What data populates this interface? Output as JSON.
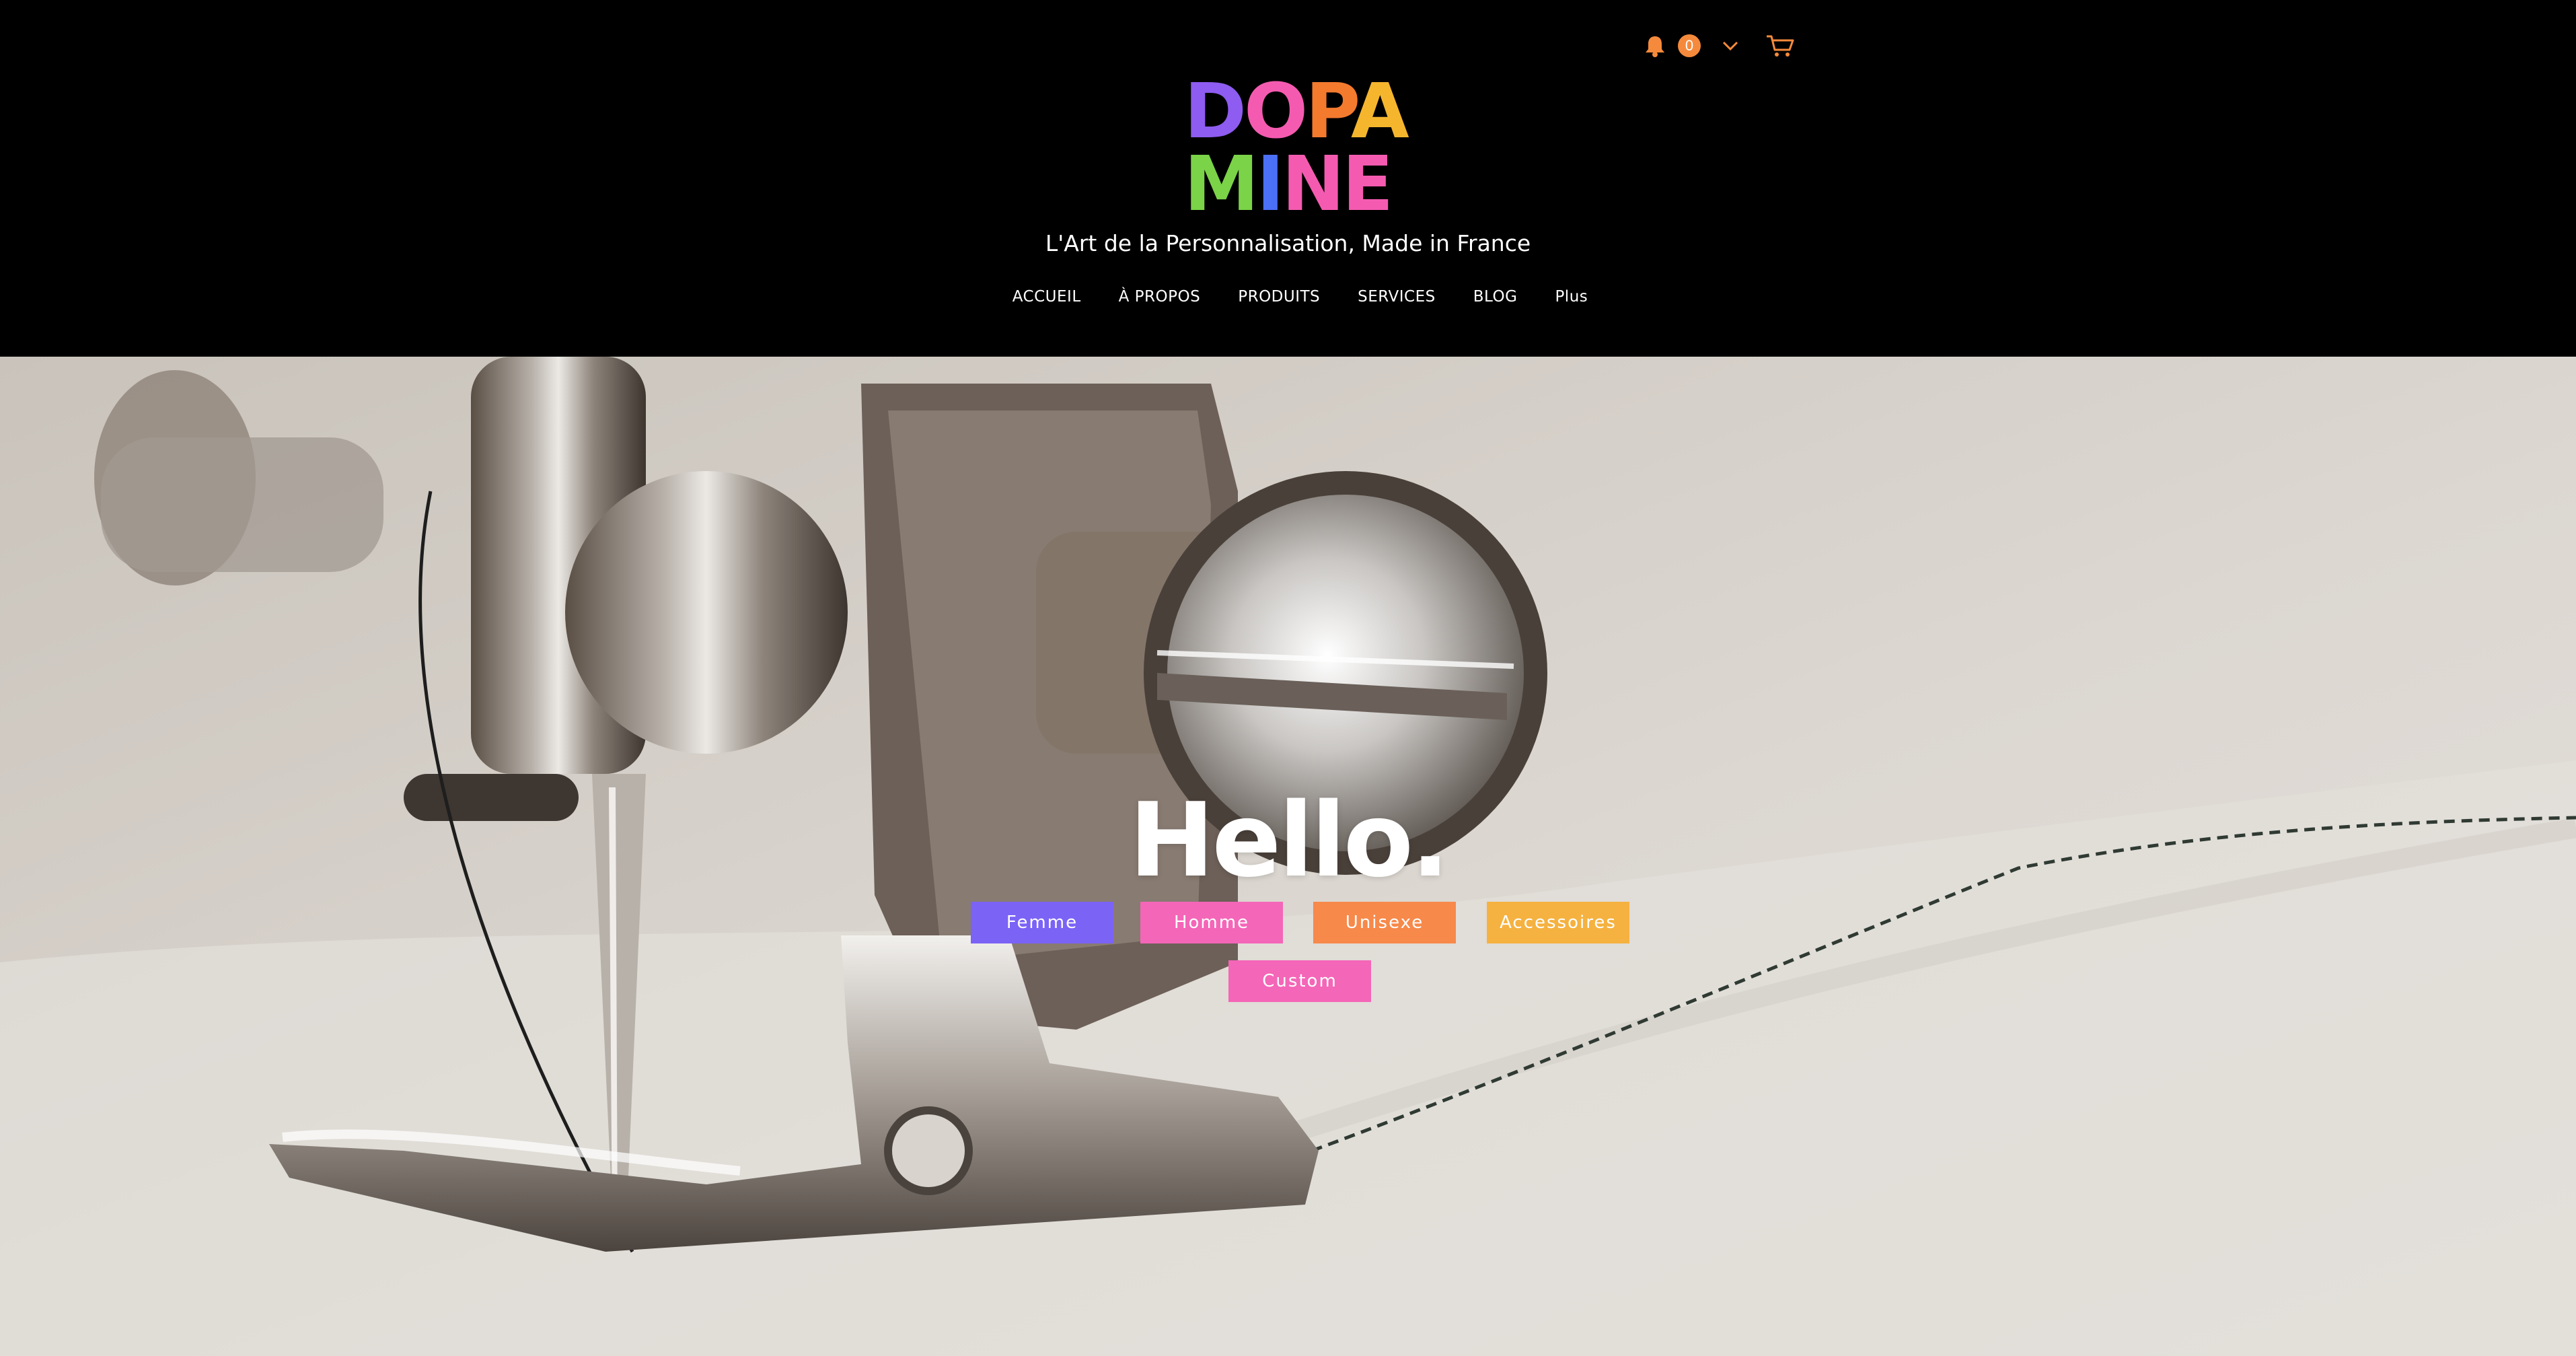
{
  "header": {
    "logo": {
      "line1": [
        "D",
        "O",
        "P",
        "A"
      ],
      "line2": [
        "M",
        "I",
        "N",
        "E"
      ],
      "colors_line1": [
        "#8E5CF0",
        "#F45BB0",
        "#F47A2E",
        "#F5B62E"
      ],
      "colors_line2": [
        "#7BD348",
        "#4B6FF5",
        "#F45BB0",
        "#F45BB0"
      ]
    },
    "tagline": "L'Art de la Personnalisation, Made in France",
    "nav": [
      "ACCUEIL",
      "À PROPOS",
      "PRODUITS",
      "SERVICES",
      "BLOG",
      "Plus"
    ],
    "utility": {
      "notification_count": "0",
      "accent_color": "#F58A3C",
      "icons": [
        "bell-icon",
        "chevron-down-icon",
        "cart-icon"
      ]
    }
  },
  "hero": {
    "title": "Hello.",
    "categories": [
      {
        "label": "Femme",
        "color": "#7B63F6"
      },
      {
        "label": "Homme",
        "color": "#F466B8"
      },
      {
        "label": "Unisexe",
        "color": "#F7894A"
      },
      {
        "label": "Accessoires",
        "color": "#F5B240"
      },
      {
        "label": "Custom",
        "color": "#F466B8"
      }
    ]
  }
}
